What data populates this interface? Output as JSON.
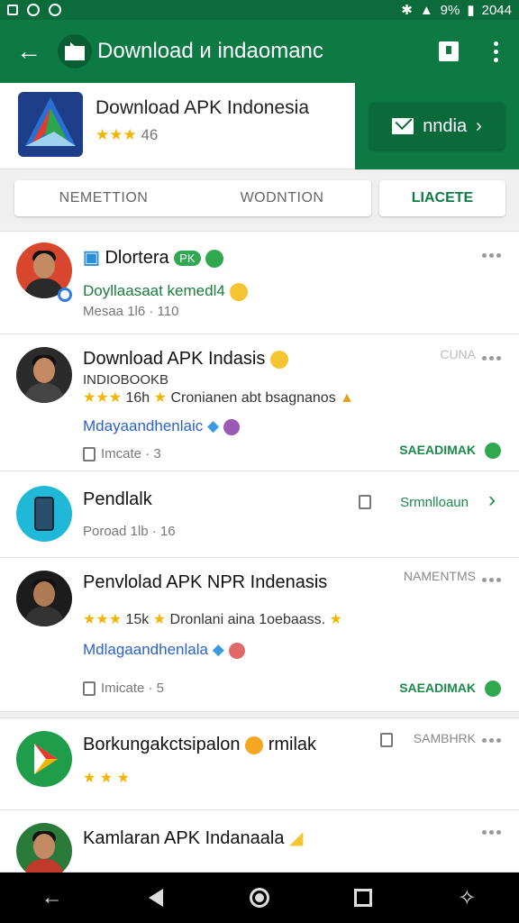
{
  "status": {
    "battery_text": "9%",
    "time": "2044"
  },
  "appbar": {
    "title": "Download и indaomanc",
    "colors": {
      "bar": "#0d7a44",
      "status": "#0b6b3a"
    }
  },
  "header": {
    "app_name": "Download APK Indonesia",
    "rating": "46",
    "install_label": "nndia"
  },
  "tabs": {
    "tab1": "NEMETTION",
    "tab2": "WODNTION",
    "tab3": "LIACETE"
  },
  "feed": [
    {
      "title": "Dlortera",
      "pill": "PK",
      "green_text": "Doyllaasaat kemedl4",
      "meta": "Mesaa 1l6 · 110"
    },
    {
      "title": "Download APK Indasis",
      "subtitle": "INDIOBOOKB",
      "stars_text": "16h",
      "stars_desc": "Cronianen abt bsagnanos",
      "link_text": "Mdayaandhenlaic",
      "meta_label": "Imcate · 3",
      "right_top": "CUNA",
      "right_green": "SAEADIMAK"
    },
    {
      "title": "Pendlalk",
      "meta": "Poroad 1lb · 16",
      "right_green": "Srmnlloaun"
    },
    {
      "title": "Penvlolad APK NPR Indenasis",
      "stars_text": "15k",
      "stars_desc": "Dronlani aina 1oebaass.",
      "link_text": "Mdlagaandhenlala",
      "meta_label": "Imicate · 5",
      "right_top": "NAMENTMS",
      "right_green": "SAEADIMAK"
    },
    {
      "title": "Borkungakctsipalon",
      "title_suffix": "rmilak",
      "right_top": "SAMBHRK"
    },
    {
      "title": "Kamlaran APK Indanaala"
    }
  ]
}
